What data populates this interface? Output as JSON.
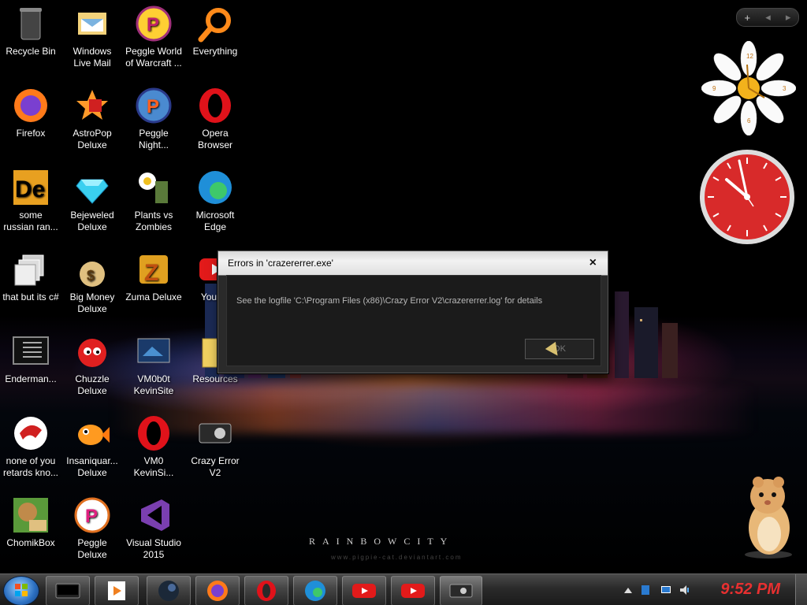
{
  "desktop": {
    "icons": [
      {
        "id": "recycle-bin",
        "label": "Recycle Bin",
        "col": 0,
        "row": 0
      },
      {
        "id": "windows-live-mail",
        "label": "Windows\nLive Mail",
        "col": 1,
        "row": 0
      },
      {
        "id": "peggle-world-of-warcraft",
        "label": "Peggle World\nof Warcraft ...",
        "col": 2,
        "row": 0
      },
      {
        "id": "everything",
        "label": "Everything",
        "col": 3,
        "row": 0
      },
      {
        "id": "firefox",
        "label": "Firefox",
        "col": 0,
        "row": 1
      },
      {
        "id": "astropop",
        "label": "AstroPop\nDeluxe",
        "col": 1,
        "row": 1
      },
      {
        "id": "peggle-nights",
        "label": "Peggle\nNight...",
        "col": 2,
        "row": 1
      },
      {
        "id": "opera-browser",
        "label": "Opera\nBrowser",
        "col": 3,
        "row": 1
      },
      {
        "id": "some-russian",
        "label": "some\nrussian ran...",
        "col": 0,
        "row": 2
      },
      {
        "id": "bejeweled",
        "label": "Bejeweled\nDeluxe",
        "col": 1,
        "row": 2
      },
      {
        "id": "plants-vs-zombies",
        "label": "Plants vs\nZombies",
        "col": 2,
        "row": 2
      },
      {
        "id": "microsoft-edge",
        "label": "Microsoft\nEdge",
        "col": 3,
        "row": 2
      },
      {
        "id": "that-but-its-csharp",
        "label": "that but its c#",
        "col": 0,
        "row": 3
      },
      {
        "id": "big-money",
        "label": "Big Money\nDeluxe",
        "col": 1,
        "row": 3
      },
      {
        "id": "zuma-deluxe",
        "label": "Zuma Deluxe",
        "col": 2,
        "row": 3
      },
      {
        "id": "youtube",
        "label": "YouT...",
        "col": 3,
        "row": 3
      },
      {
        "id": "enderman",
        "label": "Enderman...",
        "col": 0,
        "row": 4
      },
      {
        "id": "chuzzle",
        "label": "Chuzzle\nDeluxe",
        "col": 1,
        "row": 4
      },
      {
        "id": "vm0b0t-kevinsite",
        "label": "VM0b0t\nKevinSite",
        "col": 2,
        "row": 4
      },
      {
        "id": "resources",
        "label": "Resources",
        "col": 3,
        "row": 4
      },
      {
        "id": "none-of-you",
        "label": "none of you\nretards kno...",
        "col": 0,
        "row": 5
      },
      {
        "id": "insaniquarium",
        "label": "Insaniquar...\nDeluxe",
        "col": 1,
        "row": 5
      },
      {
        "id": "vm0-kevinsi",
        "label": "VM0\nKevinSi...",
        "col": 2,
        "row": 5
      },
      {
        "id": "crazy-error-v2",
        "label": "Crazy Error\nV2",
        "col": 3,
        "row": 5
      },
      {
        "id": "chomikbox",
        "label": "ChomikBox",
        "col": 0,
        "row": 6
      },
      {
        "id": "peggle-deluxe",
        "label": "Peggle\nDeluxe",
        "col": 1,
        "row": 6
      },
      {
        "id": "visual-studio-2015",
        "label": "Visual Studio\n2015",
        "col": 2,
        "row": 6
      }
    ],
    "wallpaper_brand": "RAINBOWCITY",
    "wallpaper_sub": "www.pigpie-cat.deviantart.com"
  },
  "dialog": {
    "title": "Errors in 'crazererrer.exe'",
    "close": "×",
    "message": "See the logfile 'C:\\Program Files (x86)\\Crazy Error V2\\crazererrer.log' for details",
    "ok": "OK"
  },
  "gadgets": {
    "bar": {
      "add": "+",
      "prev": "◂",
      "next": "▸"
    },
    "flower_clock_numbers": [
      "12",
      "3",
      "6",
      "9"
    ]
  },
  "taskbar": {
    "clock": "9:52 PM",
    "buttons": [
      "terminal",
      "media-player",
      "steam",
      "firefox",
      "opera",
      "edge",
      "youtube",
      "youtube",
      "crazy-error"
    ]
  },
  "colors": {
    "clock": "#e83030",
    "accent": "#2b6fc1"
  }
}
